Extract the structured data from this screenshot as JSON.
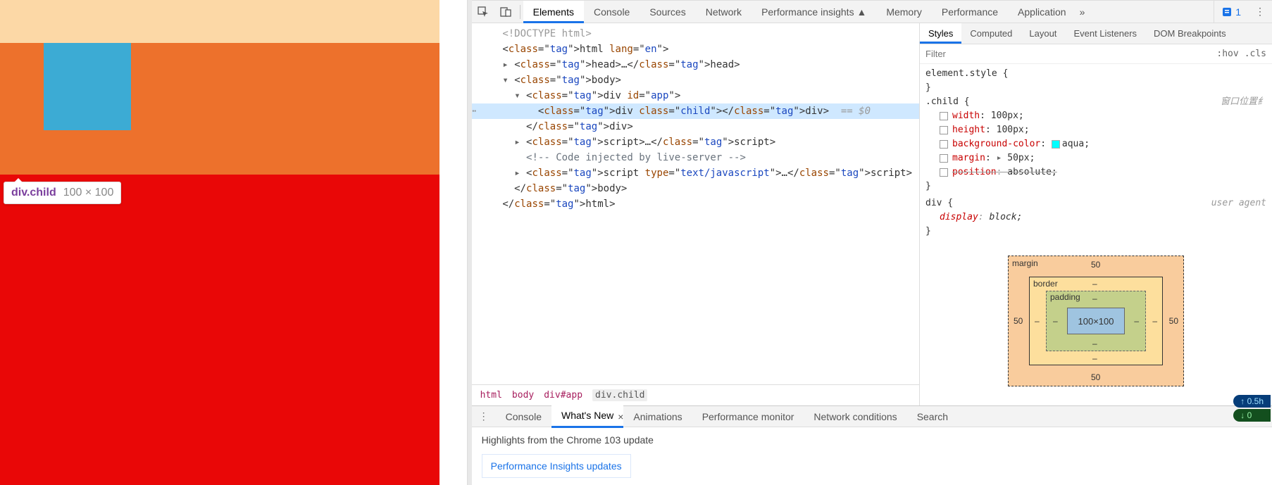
{
  "inspect_tooltip": {
    "selector": "div.child",
    "dimensions": "100 × 100"
  },
  "devtools_tabs": {
    "items": [
      "Elements",
      "Console",
      "Sources",
      "Network",
      "Performance insights ▲",
      "Memory",
      "Performance",
      "Application"
    ],
    "active": "Elements",
    "overflow_glyph": "»",
    "issues_count": "1"
  },
  "dom_tree": {
    "lines": [
      {
        "indent": 0,
        "html": "<!DOCTYPE html>",
        "kind": "doctype"
      },
      {
        "indent": 0,
        "html": "<html lang=\"en\">",
        "kind": "open"
      },
      {
        "indent": 1,
        "html": "<head>…</head>",
        "kind": "collapsed",
        "arrow": "▸"
      },
      {
        "indent": 1,
        "html": "<body>",
        "kind": "open",
        "arrow": "▾"
      },
      {
        "indent": 2,
        "html": "<div id=\"app\">",
        "kind": "open",
        "arrow": "▾"
      },
      {
        "indent": 3,
        "html": "<div class=\"child\"></div>",
        "kind": "selected",
        "suffix": "== $0"
      },
      {
        "indent": 2,
        "html": "</div>",
        "kind": "close"
      },
      {
        "indent": 2,
        "html": "<script>…</script>",
        "kind": "collapsed",
        "arrow": "▸"
      },
      {
        "indent": 2,
        "html": "<!-- Code injected by live-server -->",
        "kind": "comment"
      },
      {
        "indent": 2,
        "html": "<script type=\"text/javascript\">…</script>",
        "kind": "collapsed",
        "arrow": "▸"
      },
      {
        "indent": 1,
        "html": "</body>",
        "kind": "close"
      },
      {
        "indent": 0,
        "html": "</html>",
        "kind": "close"
      }
    ]
  },
  "breadcrumb": [
    "html",
    "body",
    "div#app",
    "div.child"
  ],
  "styles_tabs": [
    "Styles",
    "Computed",
    "Layout",
    "Event Listeners",
    "DOM Breakpoints"
  ],
  "styles_active": "Styles",
  "filter": {
    "placeholder": "Filter",
    "hov": ":hov",
    "cls": ".cls"
  },
  "rules": {
    "element_style": "element.style {",
    "child_selector": ".child {",
    "child_props": [
      {
        "name": "width",
        "value": "100px;"
      },
      {
        "name": "height",
        "value": "100px;"
      },
      {
        "name": "background-color",
        "value": "aqua;",
        "swatch": true
      },
      {
        "name": "margin",
        "value": "50px;",
        "expand": true
      },
      {
        "name": "position",
        "value": "absolute;",
        "strike": true
      }
    ],
    "child_source": "窗口位置纟",
    "div_selector": "div {",
    "div_source": "user agent",
    "div_prop": {
      "name": "display",
      "value": "block;"
    }
  },
  "box_model": {
    "margin_label": "margin",
    "border_label": "border",
    "padding_label": "padding",
    "content": "100×100",
    "margin": {
      "top": "50",
      "right": "50",
      "bottom": "50",
      "left": "50"
    },
    "border": {
      "top": "–",
      "right": "–",
      "bottom": "–",
      "left": "–"
    },
    "padding": {
      "top": "–",
      "right": "–",
      "bottom": "–",
      "left": "–"
    }
  },
  "drawer": {
    "tabs": [
      "Console",
      "What's New",
      "Animations",
      "Performance monitor",
      "Network conditions",
      "Search"
    ],
    "active": "What's New",
    "headline": "Highlights from the Chrome 103 update",
    "card": "Performance Insights updates"
  },
  "perf_pill": {
    "top": "↑ 0.5h",
    "bottom": "↓ 0"
  }
}
